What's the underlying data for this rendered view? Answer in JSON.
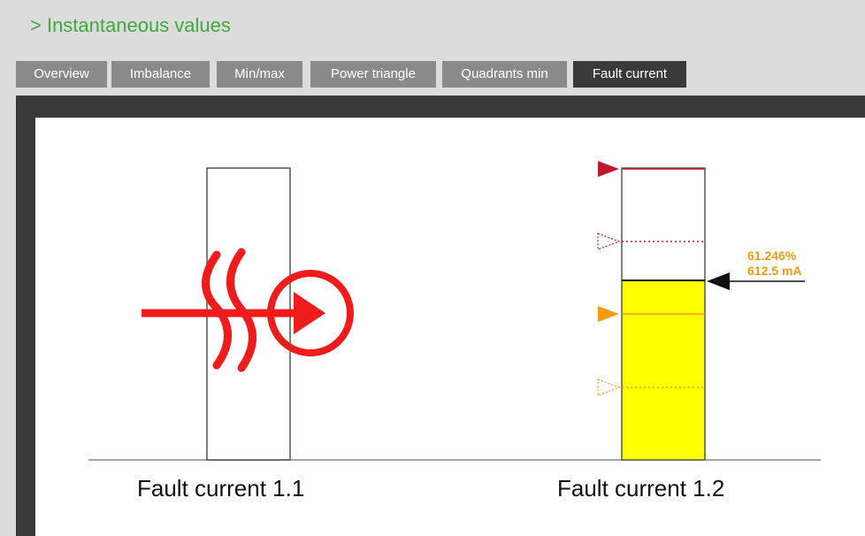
{
  "header": {
    "title": "> Instantaneous values"
  },
  "tabs": [
    {
      "label": "Overview",
      "active": false
    },
    {
      "label": "Imbalance",
      "active": false
    },
    {
      "label": "Min/max",
      "active": false
    },
    {
      "label": "Power triangle",
      "active": false
    },
    {
      "label": "Quadrants min",
      "active": false
    },
    {
      "label": "Fault current",
      "active": true
    }
  ],
  "gauges": [
    {
      "label": "Fault current 1.1",
      "icon": "fault-current-symbol-icon"
    },
    {
      "label": "Fault current 1.2",
      "percent_text": "61.246%",
      "current_text": "612.5 mA",
      "level_fraction": 0.612
    }
  ],
  "colors": {
    "title_green": "#3fa93f",
    "tab_inactive": "#8a8a8a",
    "tab_active": "#3a3a3a",
    "fill_yellow": "#ffff00",
    "alarm_red": "#c0182a",
    "warning_orange": "#f39a10",
    "symbol_red": "#ee1c1c"
  }
}
